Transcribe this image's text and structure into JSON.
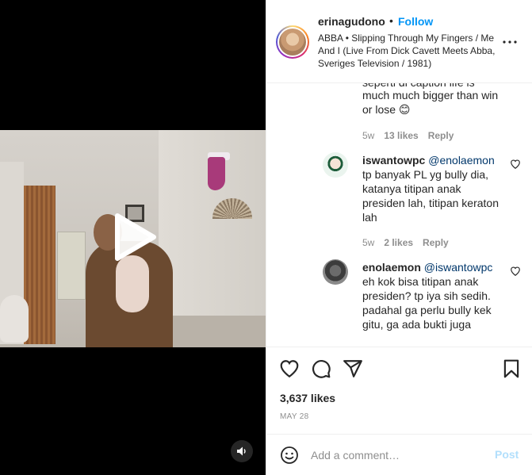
{
  "video": {
    "play_icon": "play-icon",
    "volume_icon": "volume-icon"
  },
  "header": {
    "username": "erinagudono",
    "separator": "•",
    "follow_label": "Follow",
    "audio_text": "ABBA • Slipping Through My Fingers / Me And I (Live From Dick Cavett Meets Abba, Sveriges Television / 1981)",
    "more_icon": "more-options-icon"
  },
  "comments": [
    {
      "text_partial_top": "seperti di caption life is",
      "text": "much much bigger than win or lose 😊",
      "time": "5w",
      "likes": "13 likes",
      "reply": "Reply"
    },
    {
      "username": "iswantowpc",
      "mention": "@enolaemon",
      "text": "tp banyak PL yg bully dia, katanya titipan anak presiden lah, titipan keraton lah",
      "time": "5w",
      "likes": "2 likes",
      "reply": "Reply"
    },
    {
      "username": "enolaemon",
      "mention": "@iswantowpc",
      "text": "eh kok bisa titipan anak presiden? tp iya sih sedih. padahal ga perlu bully kek gitu, ga ada bukti juga"
    }
  ],
  "actions": {
    "like_icon": "heart-icon",
    "comment_icon": "comment-icon",
    "share_icon": "share-icon",
    "save_icon": "bookmark-icon",
    "likes_count": "3,637 likes",
    "date": "MAY 28"
  },
  "add_comment": {
    "emoji_icon": "emoji-icon",
    "placeholder": "Add a comment…",
    "post_label": "Post"
  },
  "colors": {
    "link_blue": "#0095f6",
    "post_disabled": "#b2dffc",
    "muted": "#8e8e8e",
    "text": "#262626"
  }
}
